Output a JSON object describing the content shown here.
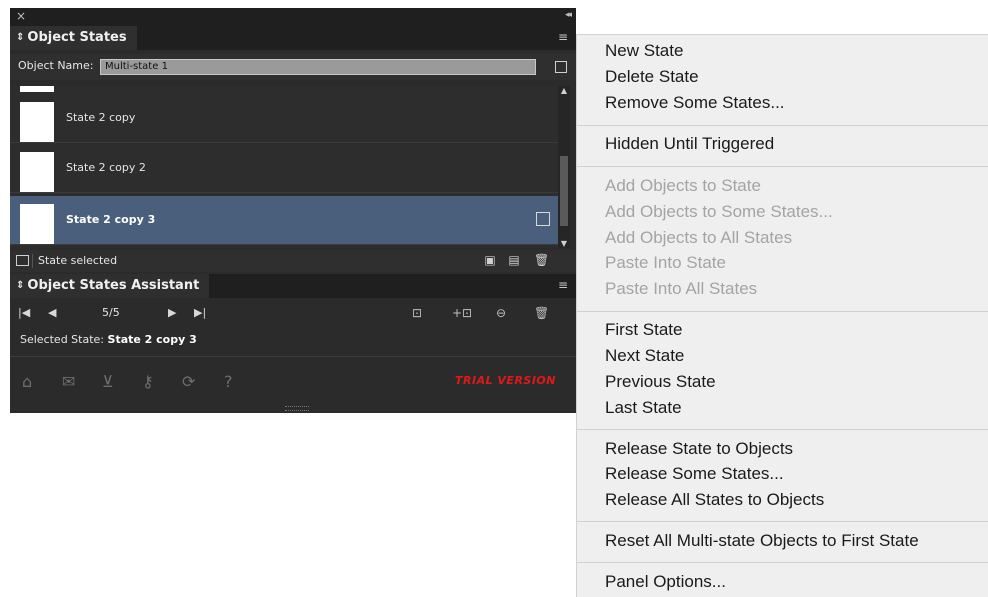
{
  "panel": {
    "object_states_tab": "Object States",
    "object_name_label": "Object Name:",
    "object_name_value": "Multi-state 1",
    "states": [
      {
        "name": "State 2 copy",
        "selected": false
      },
      {
        "name": "State 2 copy 2",
        "selected": false
      },
      {
        "name": "State 2 copy 3",
        "selected": true
      }
    ],
    "status_text": "State selected",
    "assistant_tab": "Object States Assistant",
    "counter": "5/5",
    "selected_state_label": "Selected State:",
    "selected_state_value": "State 2 copy 3",
    "trial_label": "TRIAL VERSION",
    "selection_color": "#4a5f7b",
    "trial_color": "#e21818"
  },
  "menu": {
    "items": [
      {
        "label": "New State",
        "enabled": true
      },
      {
        "label": "Delete State",
        "enabled": true
      },
      {
        "label": "Remove Some States...",
        "enabled": true
      },
      {
        "label": "Hidden Until Triggered",
        "enabled": true
      },
      {
        "label": "Add Objects to State",
        "enabled": false
      },
      {
        "label": "Add Objects to Some States...",
        "enabled": false
      },
      {
        "label": "Add Objects to All States",
        "enabled": false
      },
      {
        "label": "Paste Into State",
        "enabled": false
      },
      {
        "label": "Paste Into All States",
        "enabled": false
      },
      {
        "label": "First State",
        "enabled": true
      },
      {
        "label": "Next State",
        "enabled": true
      },
      {
        "label": "Previous State",
        "enabled": true
      },
      {
        "label": "Last State",
        "enabled": true
      },
      {
        "label": "Release State to Objects",
        "enabled": true
      },
      {
        "label": "Release Some States...",
        "enabled": true
      },
      {
        "label": "Release All States to Objects",
        "enabled": true
      },
      {
        "label": "Reset All Multi-state Objects to First State",
        "enabled": true
      },
      {
        "label": "Panel Options...",
        "enabled": true
      }
    ]
  }
}
